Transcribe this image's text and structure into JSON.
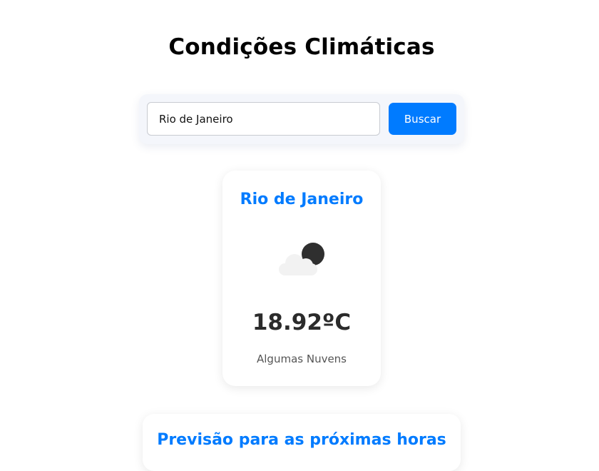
{
  "page": {
    "title": "Condições Climáticas"
  },
  "search": {
    "value": "Rio de Janeiro",
    "button_label": "Buscar"
  },
  "weather": {
    "city": "Rio de Janeiro",
    "icon": "few-clouds-night-icon",
    "temperature": "18.92ºC",
    "description": "Algumas Nuvens"
  },
  "forecast": {
    "title": "Previsão para as próximas horas"
  },
  "colors": {
    "accent": "#007bff",
    "text_dark": "#2b2b2b",
    "panel_bg": "#f4f6fb"
  }
}
